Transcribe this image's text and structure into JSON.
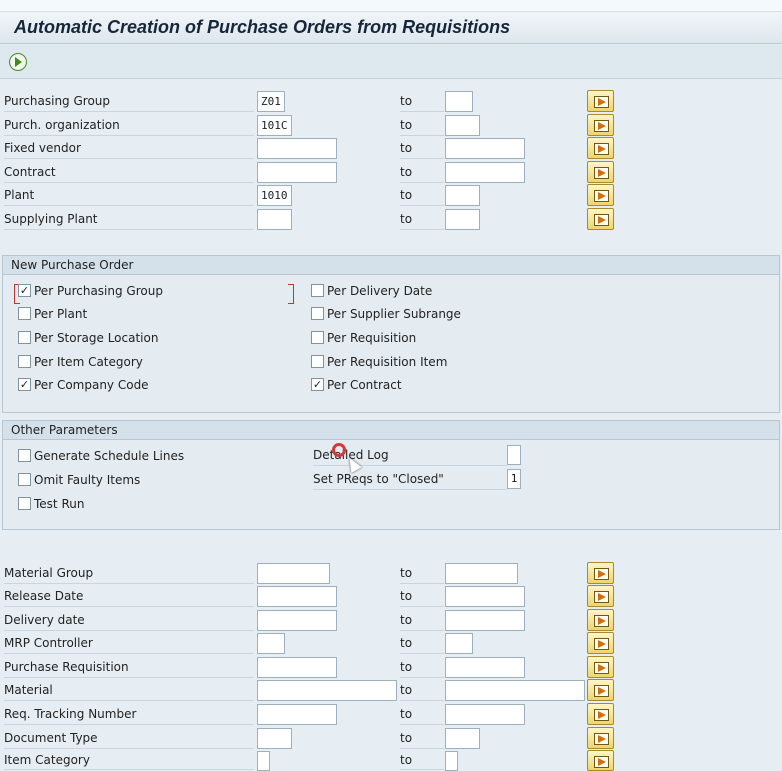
{
  "title": "Automatic Creation of Purchase Orders from Requisitions",
  "to_label": "to",
  "selection_top": [
    {
      "label": "Purchasing Group",
      "from": "Z01",
      "to": ""
    },
    {
      "label": "Purch. organization",
      "from": "101C",
      "to": ""
    },
    {
      "label": "Fixed vendor",
      "from": "",
      "to": ""
    },
    {
      "label": "Contract",
      "from": "",
      "to": ""
    },
    {
      "label": "Plant",
      "from": "1010",
      "to": ""
    },
    {
      "label": "Supplying Plant",
      "from": "",
      "to": ""
    }
  ],
  "new_po": {
    "header": "New Purchase Order",
    "left": [
      {
        "label": "Per Purchasing Group",
        "checked": true
      },
      {
        "label": "Per Plant",
        "checked": false
      },
      {
        "label": "Per Storage Location",
        "checked": false
      },
      {
        "label": "Per Item Category",
        "checked": false
      },
      {
        "label": "Per Company Code",
        "checked": true
      }
    ],
    "right": [
      {
        "label": "Per Delivery Date",
        "checked": false
      },
      {
        "label": "Per Supplier Subrange",
        "checked": false
      },
      {
        "label": "Per Requisition",
        "checked": false
      },
      {
        "label": "Per Requisition Item",
        "checked": false
      },
      {
        "label": "Per Contract",
        "checked": true
      }
    ]
  },
  "other": {
    "header": "Other Parameters",
    "left": [
      {
        "label": "Generate Schedule Lines",
        "checked": false
      },
      {
        "label": "Omit Faulty Items",
        "checked": false
      },
      {
        "label": "Test Run",
        "checked": false
      }
    ],
    "right": [
      {
        "label": "Detailed Log",
        "value": ""
      },
      {
        "label": "Set PReqs to \"Closed\"",
        "value": "1"
      }
    ]
  },
  "selection_bottom": [
    {
      "label": "Material Group",
      "from": "",
      "to": ""
    },
    {
      "label": "Release Date",
      "from": "",
      "to": ""
    },
    {
      "label": "Delivery date",
      "from": "",
      "to": ""
    },
    {
      "label": "MRP Controller",
      "from": "",
      "to": ""
    },
    {
      "label": "Purchase Requisition",
      "from": "",
      "to": ""
    },
    {
      "label": "Material",
      "from": "",
      "to": ""
    },
    {
      "label": "Req. Tracking Number",
      "from": "",
      "to": ""
    },
    {
      "label": "Document Type",
      "from": "",
      "to": ""
    },
    {
      "label": "Item Category",
      "from": "",
      "to": ""
    }
  ]
}
